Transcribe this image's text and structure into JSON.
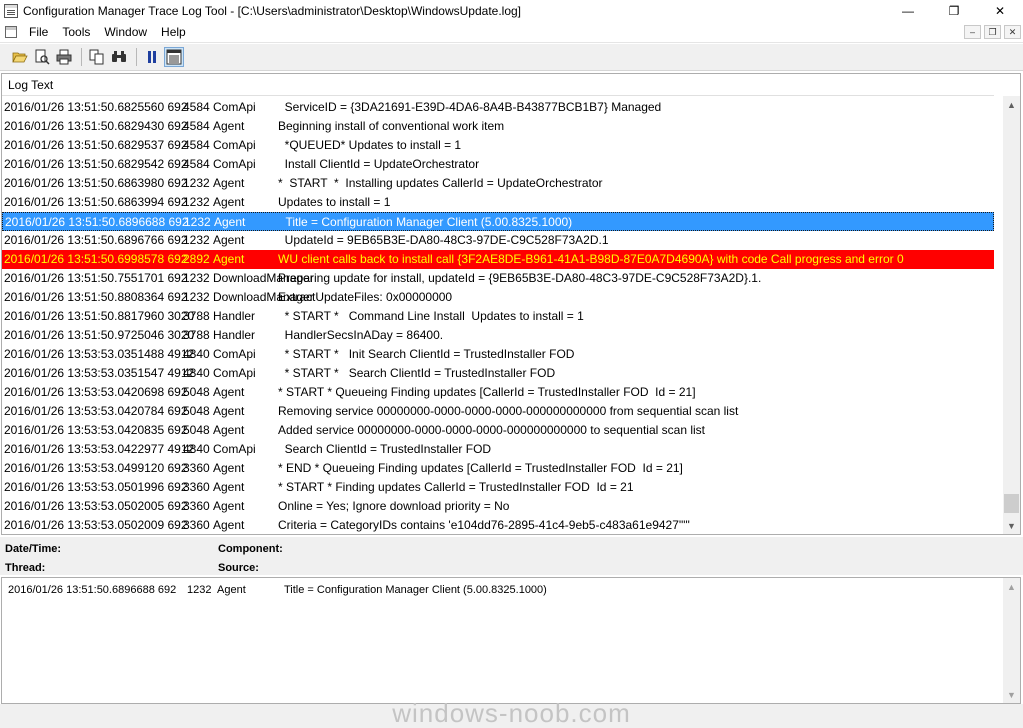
{
  "window": {
    "title": "Configuration Manager Trace Log Tool - [C:\\Users\\administrator\\Desktop\\WindowsUpdate.log]",
    "minimize_glyph": "—",
    "maximize_glyph": "❐",
    "close_glyph": "✕"
  },
  "menu": {
    "items": [
      "File",
      "Tools",
      "Window",
      "Help"
    ],
    "mdi": [
      "–",
      "❐",
      "✕"
    ]
  },
  "toolbar": {
    "icons": [
      "open-icon",
      "print-preview-icon",
      "print-icon",
      "copy-icon",
      "find-icon",
      "pause-icon",
      "details-pane-icon"
    ]
  },
  "log": {
    "header": "Log Text",
    "rows": [
      {
        "date": "2016/01/26 13:51:50.6825560 692",
        "pid": "4584",
        "comp": "ComApi",
        "text": "  ServiceID = {3DA21691-E39D-4DA6-8A4B-B43877BCB1B7} Managed",
        "state": ""
      },
      {
        "date": "2016/01/26 13:51:50.6829430 692",
        "pid": "4584",
        "comp": "Agent",
        "text": "Beginning install of conventional work item",
        "state": ""
      },
      {
        "date": "2016/01/26 13:51:50.6829537 692",
        "pid": "4584",
        "comp": "ComApi",
        "text": "  *QUEUED* Updates to install = 1",
        "state": ""
      },
      {
        "date": "2016/01/26 13:51:50.6829542 692",
        "pid": "4584",
        "comp": "ComApi",
        "text": "  Install ClientId = UpdateOrchestrator",
        "state": ""
      },
      {
        "date": "2016/01/26 13:51:50.6863980 692",
        "pid": "1232",
        "comp": "Agent",
        "text": "*  START  *  Installing updates CallerId = UpdateOrchestrator",
        "state": ""
      },
      {
        "date": "2016/01/26 13:51:50.6863994 692",
        "pid": "1232",
        "comp": "Agent",
        "text": "Updates to install = 1",
        "state": ""
      },
      {
        "date": "2016/01/26 13:51:50.6896688 692",
        "pid": "1232",
        "comp": "Agent",
        "text": "  Title = Configuration Manager Client (5.00.8325.1000)",
        "state": "selected"
      },
      {
        "date": "2016/01/26 13:51:50.6896766 692",
        "pid": "1232",
        "comp": "Agent",
        "text": "  UpdateId = 9EB65B3E-DA80-48C3-97DE-C9C528F73A2D.1",
        "state": ""
      },
      {
        "date": "2016/01/26 13:51:50.6998578 692",
        "pid": "2892",
        "comp": "Agent",
        "text": "WU client calls back to install call {3F2AE8DE-B961-41A1-B98D-87E0A7D4690A} with code Call progress and error 0",
        "state": "error"
      },
      {
        "date": "2016/01/26 13:51:50.7551701 692",
        "pid": "1232",
        "comp": "DownloadManager",
        "text": "Preparing update for install, updateId = {9EB65B3E-DA80-48C3-97DE-C9C528F73A2D}.1.",
        "state": ""
      },
      {
        "date": "2016/01/26 13:51:50.8808364 692",
        "pid": "1232",
        "comp": "DownloadManager",
        "text": "ExtractUpdateFiles: 0x00000000",
        "state": ""
      },
      {
        "date": "2016/01/26 13:51:50.8817960 3020",
        "pid": "3788",
        "comp": "Handler",
        "text": "  * START *   Command Line Install  Updates to install = 1",
        "state": ""
      },
      {
        "date": "2016/01/26 13:51:50.9725046 3020",
        "pid": "3788",
        "comp": "Handler",
        "text": "  HandlerSecsInADay = 86400.",
        "state": ""
      },
      {
        "date": "2016/01/26 13:53:53.0351488 4912",
        "pid": "4840",
        "comp": "ComApi",
        "text": "  * START *   Init Search ClientId = TrustedInstaller FOD",
        "state": ""
      },
      {
        "date": "2016/01/26 13:53:53.0351547 4912",
        "pid": "4840",
        "comp": "ComApi",
        "text": "  * START *   Search ClientId = TrustedInstaller FOD",
        "state": ""
      },
      {
        "date": "2016/01/26 13:53:53.0420698 692",
        "pid": "5048",
        "comp": "Agent",
        "text": "* START * Queueing Finding updates [CallerId = TrustedInstaller FOD  Id = 21]",
        "state": ""
      },
      {
        "date": "2016/01/26 13:53:53.0420784 692",
        "pid": "5048",
        "comp": "Agent",
        "text": "Removing service 00000000-0000-0000-0000-000000000000 from sequential scan list",
        "state": ""
      },
      {
        "date": "2016/01/26 13:53:53.0420835 692",
        "pid": "5048",
        "comp": "Agent",
        "text": "Added service 00000000-0000-0000-0000-000000000000 to sequential scan list",
        "state": ""
      },
      {
        "date": "2016/01/26 13:53:53.0422977 4912",
        "pid": "4840",
        "comp": "ComApi",
        "text": "  Search ClientId = TrustedInstaller FOD",
        "state": ""
      },
      {
        "date": "2016/01/26 13:53:53.0499120 692",
        "pid": "3360",
        "comp": "Agent",
        "text": "* END * Queueing Finding updates [CallerId = TrustedInstaller FOD  Id = 21]",
        "state": ""
      },
      {
        "date": "2016/01/26 13:53:53.0501996 692",
        "pid": "3360",
        "comp": "Agent",
        "text": "* START * Finding updates CallerId = TrustedInstaller FOD  Id = 21",
        "state": ""
      },
      {
        "date": "2016/01/26 13:53:53.0502005 692",
        "pid": "3360",
        "comp": "Agent",
        "text": "Online = Yes; Ignore download priority = No",
        "state": ""
      },
      {
        "date": "2016/01/26 13:53:53.0502009 692",
        "pid": "3360",
        "comp": "Agent",
        "text": "Criteria = CategoryIDs contains 'e104dd76-2895-41c4-9eb5-c483a61e9427'\"\"",
        "state": ""
      }
    ]
  },
  "details": {
    "datetime_label": "Date/Time:",
    "component_label": "Component:",
    "thread_label": "Thread:",
    "source_label": "Source:"
  },
  "detail_text": {
    "date": "2016/01/26 13:51:50.6896688 692",
    "pid": "1232",
    "comp": "Agent",
    "text": "Title = Configuration Manager Client (5.00.8325.1000)"
  },
  "watermark": "windows-noob.com",
  "colors": {
    "selected_bg": "#3399ff",
    "error_bg": "#ff0000",
    "error_text": "#ffff00"
  }
}
